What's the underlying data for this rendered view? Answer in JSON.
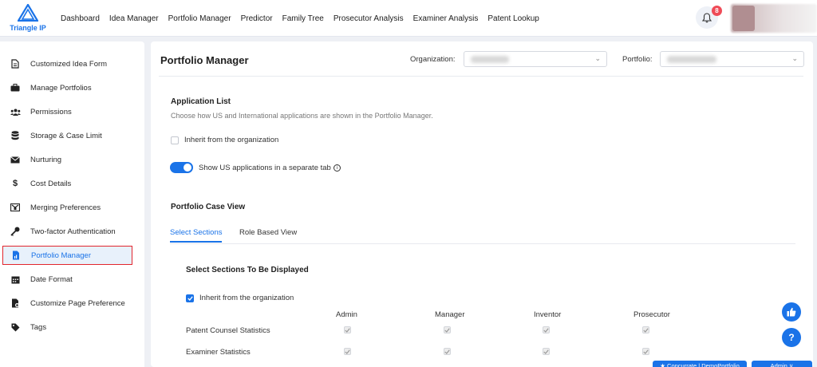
{
  "brand": {
    "name": "Triangle IP",
    "accent": "#1a73e8"
  },
  "nav": {
    "items": [
      "Dashboard",
      "Idea Manager",
      "Portfolio Manager",
      "Predictor",
      "Family Tree",
      "Prosecutor Analysis",
      "Examiner Analysis",
      "Patent Lookup"
    ],
    "notification_count": "8"
  },
  "sidebar": {
    "items": [
      {
        "label": "Customized Idea Form",
        "icon": "document-icon"
      },
      {
        "label": "Manage Portfolios",
        "icon": "briefcase-icon"
      },
      {
        "label": "Permissions",
        "icon": "users-icon"
      },
      {
        "label": "Storage & Case Limit",
        "icon": "database-icon"
      },
      {
        "label": "Nurturing",
        "icon": "envelope-icon"
      },
      {
        "label": "Cost Details",
        "icon": "dollar-icon"
      },
      {
        "label": "Merging Preferences",
        "icon": "merge-icon"
      },
      {
        "label": "Two-factor Authentication",
        "icon": "key-icon"
      },
      {
        "label": "Portfolio Manager",
        "icon": "file-chart-icon",
        "active": true
      },
      {
        "label": "Date Format",
        "icon": "calendar-icon"
      },
      {
        "label": "Customize Page Preference",
        "icon": "file-settings-icon"
      },
      {
        "label": "Tags",
        "icon": "tag-icon"
      }
    ]
  },
  "main": {
    "title": "Portfolio Manager",
    "organization_label": "Organization:",
    "portfolio_label": "Portfolio:",
    "application_list": {
      "title": "Application List",
      "description": "Choose how US and International applications are shown in the Portfolio Manager.",
      "inherit_label": "Inherit from the organization",
      "inherit_checked": false,
      "toggle_label": "Show US applications in a separate tab",
      "toggle_on": true
    },
    "case_view": {
      "title": "Portfolio Case View",
      "tabs": [
        "Select Sections",
        "Role Based View"
      ],
      "active_tab": "Select Sections",
      "sections_title": "Select Sections To Be Displayed",
      "inherit_label": "Inherit from the organization",
      "inherit_checked": true,
      "columns": [
        "Admin",
        "Manager",
        "Inventor",
        "Prosecutor"
      ],
      "rows": [
        {
          "label": "Patent Counsel Statistics",
          "checked": [
            true,
            true,
            true,
            true
          ]
        },
        {
          "label": "Examiner Statistics",
          "checked": [
            true,
            true,
            true,
            true
          ]
        }
      ]
    }
  },
  "footer": {
    "concurrate_label": "★ Concurrate | DemoPortfolio",
    "admin_label": "Admin ∨"
  }
}
